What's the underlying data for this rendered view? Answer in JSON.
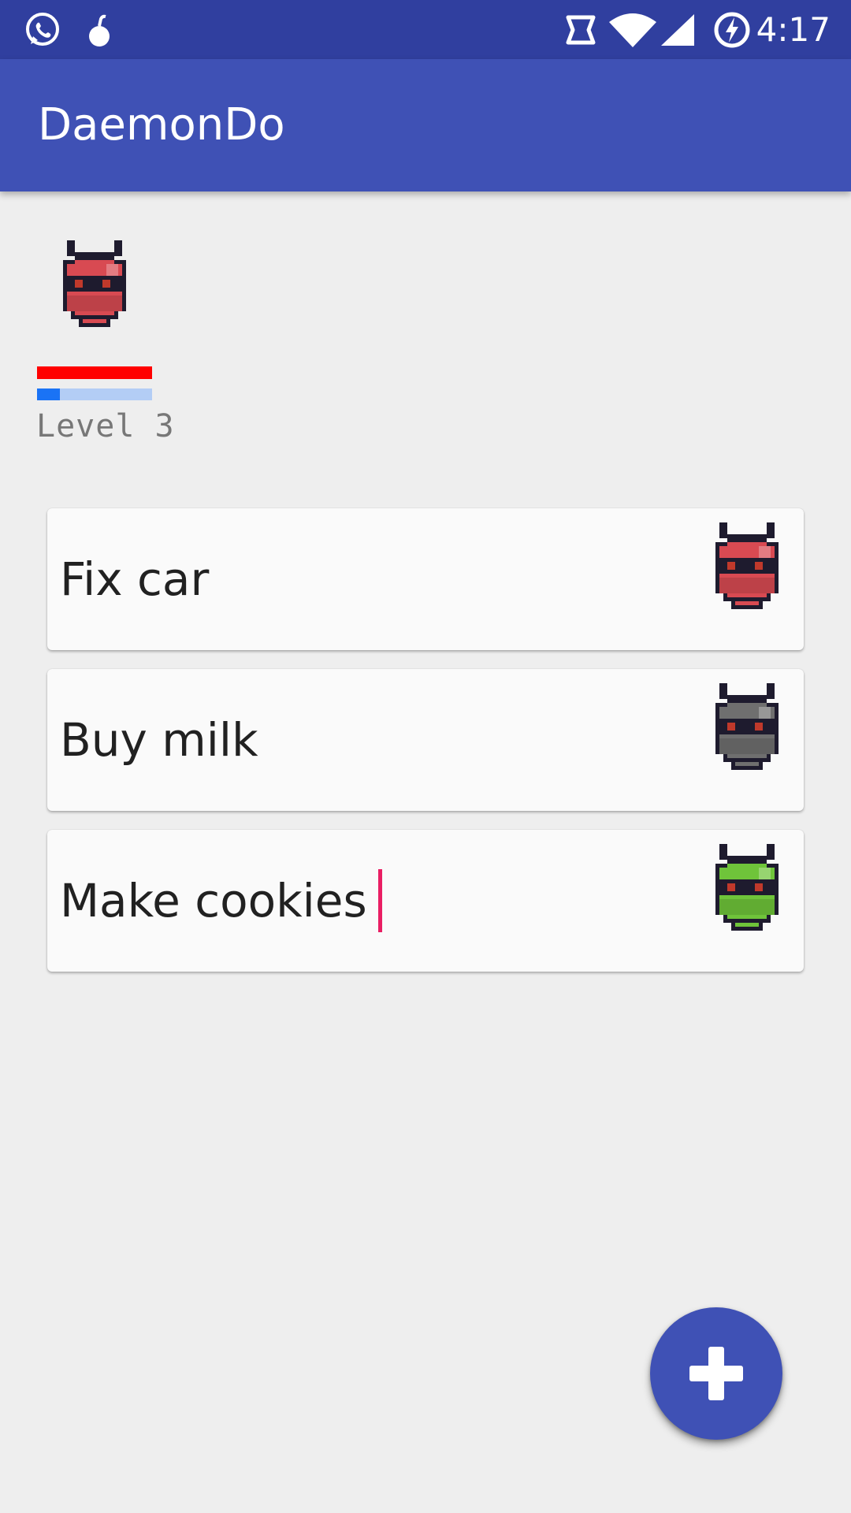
{
  "status_bar": {
    "time": "4:17",
    "left_icons": [
      "whatsapp-icon",
      "bomb-notification-icon"
    ],
    "right_icons": [
      "nfc-icon",
      "wifi-icon",
      "cell-signal-icon",
      "battery-charging-icon"
    ]
  },
  "app_bar": {
    "title": "DaemonDo"
  },
  "player": {
    "level_label": "Level 3",
    "health_fraction": 1.0,
    "xp_fraction": 0.2,
    "colors": {
      "health": "#ff0000",
      "xp_fill": "#1a73f5",
      "xp_track": "#b3cdf5"
    }
  },
  "tasks": [
    {
      "text": "Fix car",
      "daemon_color": "#d84a52"
    },
    {
      "text": "Buy milk",
      "daemon_color": "#6f6f6f"
    },
    {
      "text": "Make cookies",
      "daemon_color": "#6fc43a"
    }
  ],
  "fab": {
    "icon": "plus-icon"
  },
  "colors": {
    "primary": "#3f51b5",
    "primary_dark": "#303f9f",
    "accent": "#e91e63"
  }
}
